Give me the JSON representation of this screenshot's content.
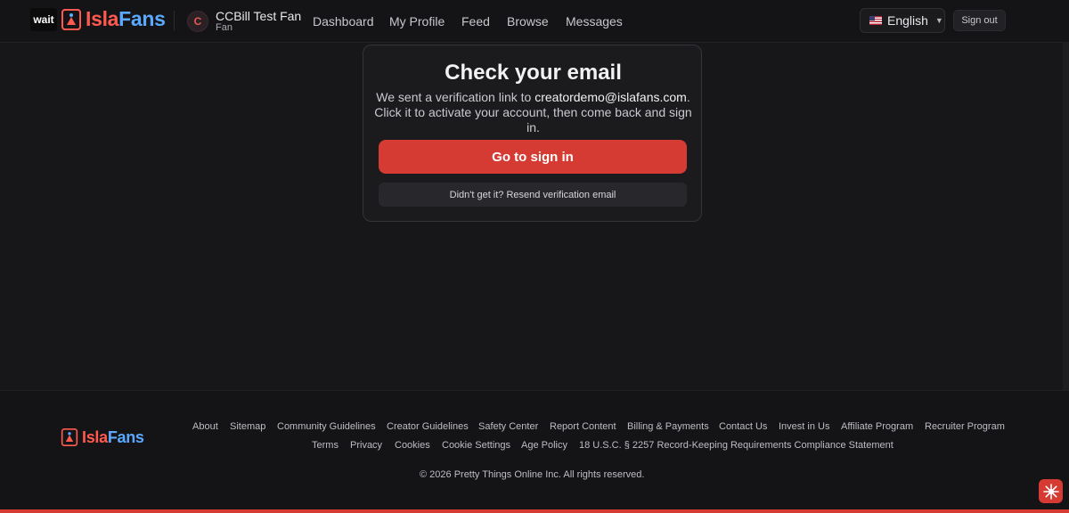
{
  "header": {
    "wait_tag": "wait",
    "logo": {
      "i": "Isla",
      "f": "Fans"
    },
    "avatar_initial": "C",
    "user_name": "CCBill Test Fan",
    "user_role": "Fan",
    "nav": [
      "Dashboard",
      "My Profile",
      "Feed",
      "Browse",
      "Messages"
    ],
    "language": {
      "label": "English",
      "flag_icon": "us-flag-icon"
    },
    "signout_label": "Sign out"
  },
  "card": {
    "title": "Check your email",
    "text_before": "We sent a verification link to",
    "email": "creatordemo@islafans.com",
    "text_after": ". Click it to activate your account, then come back and sign in.",
    "primary_button": "Go to sign in",
    "secondary_button": "Didn't get it? Resend verification email"
  },
  "footer": {
    "row1": [
      "About",
      "Sitemap",
      "Community Guidelines",
      "Creator Guidelines",
      "Safety Center",
      "Report Content",
      "Billing & Payments",
      "Contact Us",
      "Invest in Us",
      "Affiliate Program",
      "Recruiter Program"
    ],
    "row2": [
      "Terms",
      "Privacy",
      "Cookies",
      "Cookie Settings",
      "Age Policy",
      "18 U.S.C. § 2257 Record-Keeping Requirements Compliance Statement"
    ],
    "copyright": "© 2026 Pretty Things Online Inc. All rights reserved."
  },
  "colors": {
    "accent": "#d53a33",
    "background": "#17171a",
    "logo_isla": "#ff5a4f",
    "logo_fans": "#5aa9ff"
  }
}
